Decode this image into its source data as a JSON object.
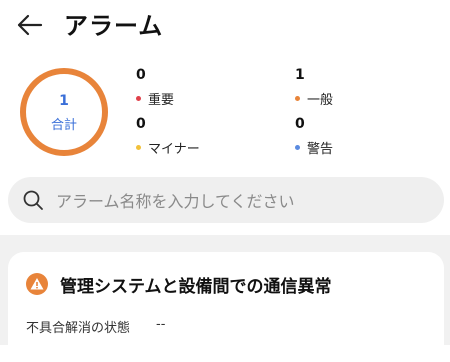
{
  "header": {
    "title": "アラーム"
  },
  "summary": {
    "total": {
      "count": "1",
      "label": "合計"
    },
    "stats": [
      {
        "count": "0",
        "label": "重要",
        "color": "#e0404a"
      },
      {
        "count": "1",
        "label": "一般",
        "color": "#e8843a"
      },
      {
        "count": "0",
        "label": "マイナー",
        "color": "#f2c13a"
      },
      {
        "count": "0",
        "label": "警告",
        "color": "#5b8be0"
      }
    ],
    "ring_color": "#e8843a"
  },
  "search": {
    "placeholder": "アラーム名称を入力してください",
    "value": ""
  },
  "alarms": [
    {
      "title": "管理システムと設備間での通信異常",
      "field_label": "不具合解消の状態",
      "field_value": "--",
      "icon": "warning-icon",
      "color": "#e8843a"
    }
  ]
}
